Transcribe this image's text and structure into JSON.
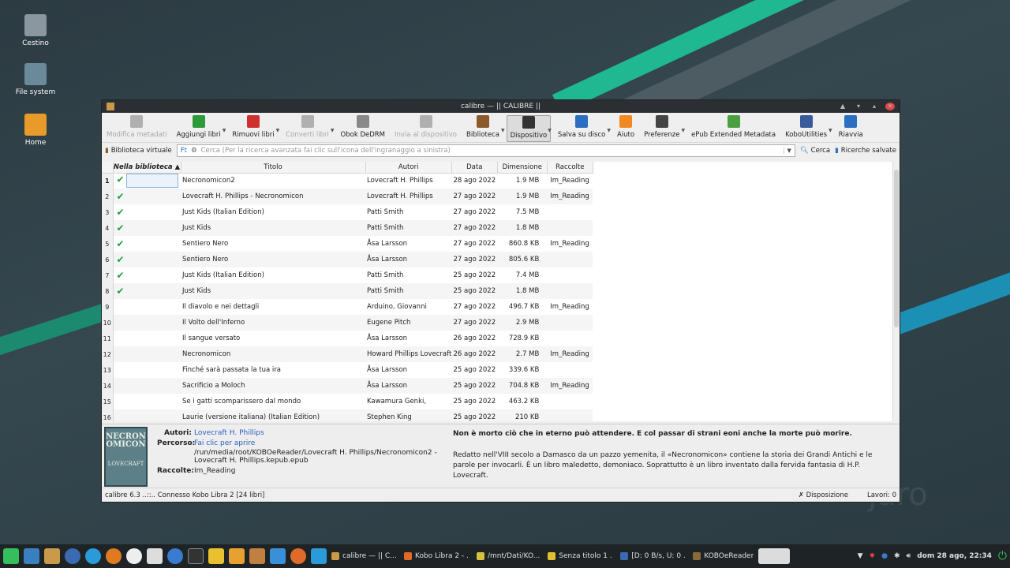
{
  "desktop": {
    "icons": [
      {
        "label": "Cestino"
      },
      {
        "label": "File system"
      },
      {
        "label": "Home"
      }
    ],
    "watermark": "jaro"
  },
  "window": {
    "title": "calibre — || CALIBRE ||",
    "toolbar": [
      {
        "label": "Modifica metadati",
        "disabled": true,
        "color": "#b0b0b0",
        "icon": "edit-metadata-icon"
      },
      {
        "label": "Aggiungi libri",
        "color": "#2e9a3a",
        "icon": "add-book-icon"
      },
      {
        "label": "Rimuovi libri",
        "color": "#d03030",
        "icon": "remove-book-icon"
      },
      {
        "label": "Converti libri",
        "disabled": true,
        "color": "#b0b0b0",
        "icon": "convert-book-icon"
      },
      {
        "label": "Obok DeDRM",
        "color": "#888888",
        "icon": "obok-icon"
      },
      {
        "label": "Invia al dispositivo",
        "disabled": true,
        "color": "#b0b0b0",
        "icon": "send-device-icon"
      },
      {
        "label": "Biblioteca",
        "color": "#8a5a2a",
        "icon": "library-icon"
      },
      {
        "label": "Dispositivo",
        "active": true,
        "color": "#333333",
        "icon": "device-icon"
      },
      {
        "label": "Salva su disco",
        "color": "#2a6fc2",
        "icon": "save-disk-icon"
      },
      {
        "label": "Aiuto",
        "color": "#f08a20",
        "icon": "help-icon"
      },
      {
        "label": "Preferenze",
        "color": "#444444",
        "icon": "preferences-icon"
      },
      {
        "label": "ePub Extended Metadata",
        "color": "#4aa040",
        "icon": "epub-metadata-icon"
      },
      {
        "label": "KoboUtilities",
        "color": "#3a5a9a",
        "icon": "kobo-icon"
      },
      {
        "label": "Riavvia",
        "color": "#2a6fc2",
        "icon": "restart-icon"
      }
    ],
    "virtual_library": "Biblioteca virtuale",
    "search": {
      "placeholder": "Cerca (Per la ricerca avanzata fai clic sull'icona dell'ingranaggio a sinistra)",
      "search_button": "Cerca",
      "saved_searches": "Ricerche salvate"
    },
    "columns": [
      "Nella biblioteca",
      "Titolo",
      "Autori",
      "Data",
      "Dimensione",
      "Raccolte"
    ],
    "books": [
      {
        "n": "1",
        "inlib": true,
        "title": "Necronomicon2",
        "author": "Lovecraft H. Phillips",
        "date": "28 ago 2022",
        "size": "1.9 MB",
        "coll": "Im_Reading"
      },
      {
        "n": "2",
        "inlib": true,
        "title": "Lovecraft H. Phillips - Necronomicon",
        "author": "Lovecraft H. Phillips",
        "date": "27 ago 2022",
        "size": "1.9 MB",
        "coll": "Im_Reading"
      },
      {
        "n": "3",
        "inlib": true,
        "title": "Just Kids (Italian Edition)",
        "author": "Patti Smith",
        "date": "27 ago 2022",
        "size": "7.5 MB",
        "coll": ""
      },
      {
        "n": "4",
        "inlib": true,
        "title": "Just Kids",
        "author": "Patti Smith",
        "date": "27 ago 2022",
        "size": "1.8 MB",
        "coll": ""
      },
      {
        "n": "5",
        "inlib": true,
        "title": "Sentiero Nero",
        "author": "Åsa Larsson",
        "date": "27 ago 2022",
        "size": "860.8 KB",
        "coll": "Im_Reading"
      },
      {
        "n": "6",
        "inlib": true,
        "title": "Sentiero Nero",
        "author": "Åsa Larsson",
        "date": "27 ago 2022",
        "size": "805.6 KB",
        "coll": ""
      },
      {
        "n": "7",
        "inlib": true,
        "title": "Just Kids (Italian Edition)",
        "author": "Patti Smith",
        "date": "25 ago 2022",
        "size": "7.4 MB",
        "coll": ""
      },
      {
        "n": "8",
        "inlib": true,
        "title": "Just Kids",
        "author": "Patti Smith",
        "date": "25 ago 2022",
        "size": "1.8 MB",
        "coll": ""
      },
      {
        "n": "9",
        "inlib": false,
        "title": "Il diavolo e nei dettagli",
        "author": "Arduino, Giovanni",
        "date": "27 ago 2022",
        "size": "496.7 KB",
        "coll": "Im_Reading"
      },
      {
        "n": "10",
        "inlib": false,
        "title": "Il Volto dell'Inferno",
        "author": "Eugene Pitch",
        "date": "27 ago 2022",
        "size": "2.9 MB",
        "coll": ""
      },
      {
        "n": "11",
        "inlib": false,
        "title": "Il sangue versato",
        "author": "Åsa Larsson",
        "date": "26 ago 2022",
        "size": "728.9 KB",
        "coll": ""
      },
      {
        "n": "12",
        "inlib": false,
        "title": "Necronomicon",
        "author": "Howard Phillips Lovecraft",
        "date": "26 ago 2022",
        "size": "2.7 MB",
        "coll": "Im_Reading"
      },
      {
        "n": "13",
        "inlib": false,
        "title": "Finché sarà passata la tua ira",
        "author": "Åsa Larsson",
        "date": "25 ago 2022",
        "size": "339.6 KB",
        "coll": ""
      },
      {
        "n": "14",
        "inlib": false,
        "title": "Sacrificio a Moloch",
        "author": "Åsa Larsson",
        "date": "25 ago 2022",
        "size": "704.8 KB",
        "coll": "Im_Reading"
      },
      {
        "n": "15",
        "inlib": false,
        "title": "Se i gatti scomparissero dal mondo",
        "author": "Kawamura Genki,",
        "date": "25 ago 2022",
        "size": "463.2 KB",
        "coll": ""
      },
      {
        "n": "16",
        "inlib": false,
        "title": "Laurie (versione italiana) (Italian Edition)",
        "author": "Stephen King",
        "date": "25 ago 2022",
        "size": "210 KB",
        "coll": ""
      }
    ],
    "details": {
      "cover_text": "NECRON OMICON",
      "cover_author": "LOVECRAFT",
      "authors_label": "Autori:",
      "authors": "Lovecraft H. Phillips",
      "path_label": "Percorso:",
      "path_link": "Fai clic per aprire",
      "path": "/run/media/root/KOBOeReader/Lovecraft H. Phillips/Necronomicon2 - Lovecraft H. Phillips.kepub.epub",
      "collections_label": "Raccolte:",
      "collections": "Im_Reading",
      "quote": "Non è morto ciò che in eterno può attendere. E col passar di strani eoni anche la morte può morire.",
      "description": "Redatto nell'VIII secolo a Damasco da un pazzo yemenita, il «Necronomicon» contiene la storia dei Grandi Antichi e le parole per invocarli. È un libro maledetto, demoniaco. Soprattutto è un libro inventato dalla fervida fantasia di H.P. Lovecraft."
    },
    "status": {
      "left": "calibre 6.3 ..::.. Connesso Kobo Libra 2   [24 libri]",
      "layout": "Disposizione",
      "jobs": "Lavori: 0"
    }
  },
  "taskbar": {
    "tasks": [
      {
        "label": "calibre — || C...",
        "color": "#c89a4a"
      },
      {
        "label": "Kobo Libra 2 - ...",
        "color": "#e06a2a"
      },
      {
        "label": "/mnt/Dati/KO...",
        "color": "#d8c040"
      },
      {
        "label": "Senza titolo 1 ...",
        "color": "#e0c030"
      },
      {
        "label": "[D: 0 B/s, U: 0 ...",
        "color": "#3a6ab0"
      },
      {
        "label": "KOBOeReader",
        "color": "#8a6a3a"
      }
    ],
    "clock": "dom 28 ago, 22:34"
  }
}
